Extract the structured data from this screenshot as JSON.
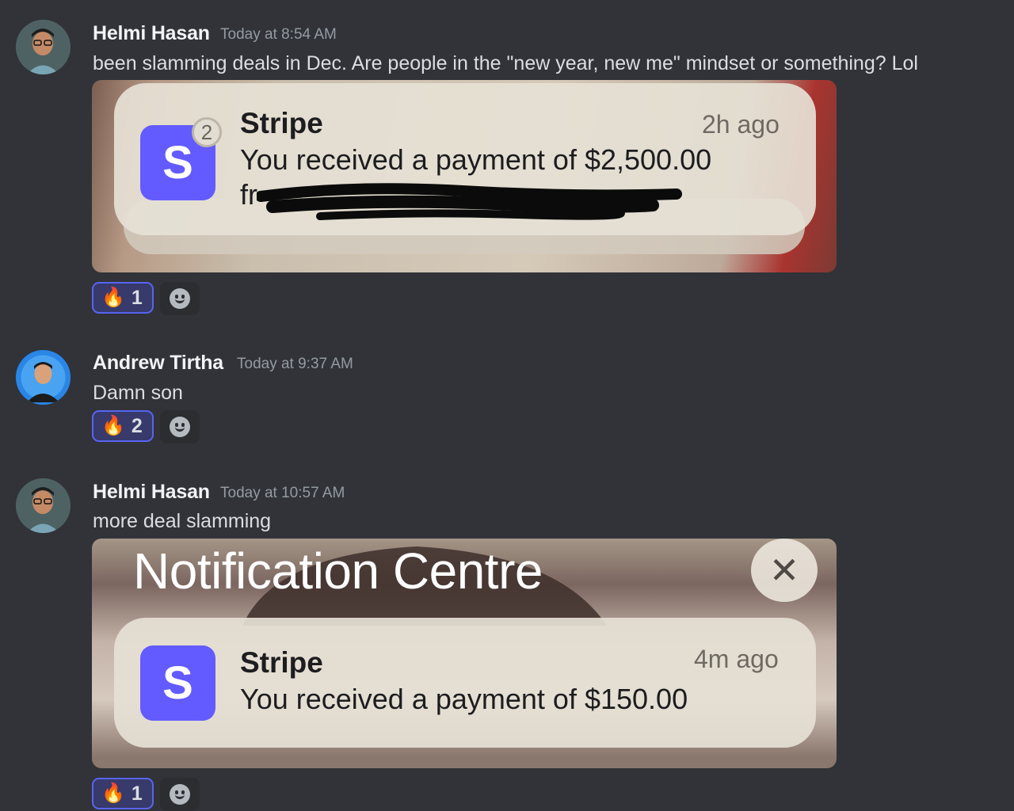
{
  "messages": [
    {
      "author": "Helmi Hasan",
      "timestamp": "Today at 8:54 AM",
      "text": "been slamming deals in Dec. Are people in the \"new year, new me\" mindset or something? Lol",
      "attachment": {
        "app": "Stripe",
        "time": "2h ago",
        "body": "You received a payment of $2,500.00",
        "body_partial": "fr",
        "badge_count": "2",
        "icon_letter": "S"
      },
      "reaction": {
        "emoji": "🔥",
        "count": "1"
      }
    },
    {
      "author": "Andrew Tirtha",
      "timestamp": "Today at 9:37 AM",
      "text": "Damn son",
      "reaction": {
        "emoji": "🔥",
        "count": "2"
      }
    },
    {
      "author": "Helmi Hasan",
      "timestamp": "Today at 10:57 AM",
      "text": "more deal slamming",
      "attachment": {
        "header": "Notification Centre",
        "close_glyph": "✕",
        "app": "Stripe",
        "time": "4m ago",
        "body": "You received a payment of $150.00",
        "icon_letter": "S"
      },
      "reaction": {
        "emoji": "🔥",
        "count": "1"
      }
    }
  ],
  "icons": {
    "reaction": "fire-emoji",
    "add_reaction": "smiley-icon",
    "notification_app": "stripe-icon"
  },
  "colors": {
    "background": "#313338",
    "reaction_border": "#5865f2",
    "stripe_brand": "#635bff"
  }
}
